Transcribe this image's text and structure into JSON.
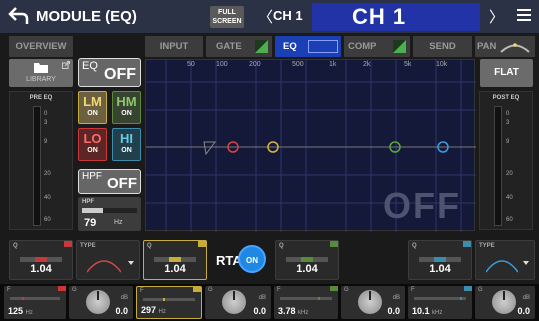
{
  "header": {
    "title": "MODULE (EQ)",
    "full_screen": "FULL SCREEN",
    "channel_small": "CH 1",
    "channel_big": "CH 1"
  },
  "tabs": [
    {
      "label": "OVERVIEW",
      "active": false
    },
    {
      "label": "INPUT",
      "active": false
    },
    {
      "label": "GATE",
      "active": false
    },
    {
      "label": "EQ",
      "active": true
    },
    {
      "label": "COMP",
      "active": false
    },
    {
      "label": "SEND",
      "active": false
    },
    {
      "label": "PAN",
      "active": false
    }
  ],
  "left": {
    "library_label": "LIBRARY",
    "eq_label": "EQ",
    "eq_state": "OFF",
    "pre_eq_label": "PRE EQ",
    "bands": [
      {
        "name": "LM",
        "state": "ON"
      },
      {
        "name": "HM",
        "state": "ON"
      },
      {
        "name": "LO",
        "state": "ON"
      },
      {
        "name": "HI",
        "state": "ON"
      }
    ],
    "hpf_label": "HPF",
    "hpf_state": "OFF",
    "hpf_freq_label": "HPF",
    "hpf_freq_value": "79",
    "hpf_freq_unit": "Hz"
  },
  "graph": {
    "freq_labels": [
      "50",
      "100",
      "200",
      "500",
      "1k",
      "2k",
      "5k",
      "10k"
    ],
    "state_text": "OFF"
  },
  "right": {
    "flat_label": "FLAT",
    "post_eq_label": "POST EQ"
  },
  "meter_scale": [
    "0",
    "3",
    "9",
    "20",
    "40",
    "60"
  ],
  "knobs": [
    {
      "label": "Q",
      "value": "1.04",
      "color": "#c83838"
    },
    {
      "label": "TYPE",
      "value": ""
    },
    {
      "label": "Q",
      "value": "1.04",
      "color": "#c8ad3c"
    },
    {
      "label": "Q",
      "value": "1.04",
      "color": "#5b8a3a"
    },
    {
      "label": "Q",
      "value": "1.04",
      "color": "#3c8dad"
    },
    {
      "label": "TYPE",
      "value": ""
    }
  ],
  "rta": {
    "label": "RTA",
    "state": "ON"
  },
  "bottom": [
    {
      "kind": "freq",
      "label": "F",
      "value": "125",
      "unit": "Hz",
      "color": "#c83838"
    },
    {
      "kind": "gain",
      "label": "G",
      "db": "dB",
      "value": "0.0",
      "color": "#c83838"
    },
    {
      "kind": "freq",
      "label": "F",
      "value": "297",
      "unit": "Hz",
      "color": "#c8ad3c"
    },
    {
      "kind": "gain",
      "label": "G",
      "db": "dB",
      "value": "0.0",
      "color": "#c8ad3c"
    },
    {
      "kind": "freq",
      "label": "F",
      "value": "3.78",
      "unit": "kHz",
      "color": "#5b8a3a"
    },
    {
      "kind": "gain",
      "label": "G",
      "db": "dB",
      "value": "0.0",
      "color": "#5b8a3a"
    },
    {
      "kind": "freq",
      "label": "F",
      "value": "10.1",
      "unit": "kHz",
      "color": "#3c8dad"
    },
    {
      "kind": "gain",
      "label": "G",
      "db": "dB",
      "value": "0.0",
      "color": "#3c8dad"
    }
  ]
}
